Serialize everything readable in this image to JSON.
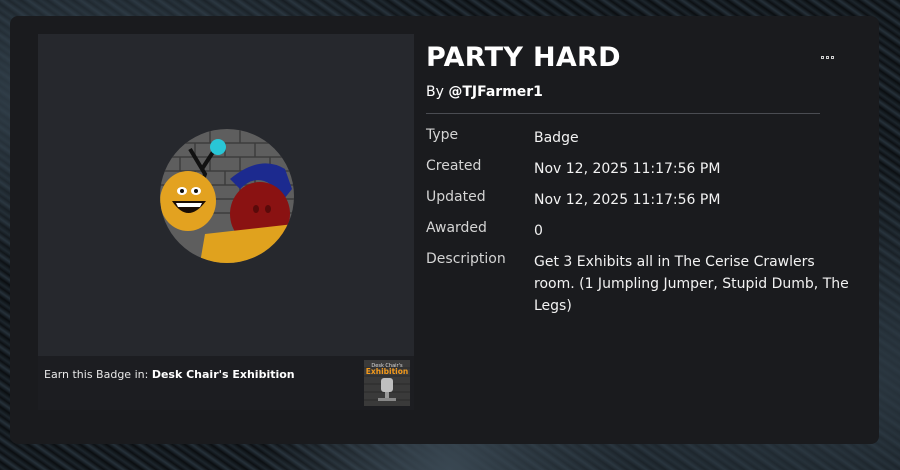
{
  "badge": {
    "title": "PARTY HARD",
    "by_prefix": "By",
    "creator": "@TJFarmer1",
    "more_icon": "ellipsis-icon"
  },
  "details": [
    {
      "label": "Type",
      "value": "Badge"
    },
    {
      "label": "Created",
      "value": "Nov 12, 2025 11:17:56 PM"
    },
    {
      "label": "Updated",
      "value": "Nov 12, 2025 11:17:56 PM"
    },
    {
      "label": "Awarded",
      "value": "0"
    },
    {
      "label": "Description",
      "value": "Get 3 Exhibits all in The Cerise Crawlers room. (1 Jumpling Jumper, Stupid Dumb, The Legs)"
    }
  ],
  "earn": {
    "prefix": "Earn this Badge in:",
    "game": "Desk Chair's Exhibition",
    "thumb_text_top": "Desk Chair's",
    "thumb_text_main": "Exhibition"
  },
  "colors": {
    "card_bg": "#1a1b1e",
    "media_bg": "#26282d",
    "thumb_title": "#f39a1c"
  }
}
